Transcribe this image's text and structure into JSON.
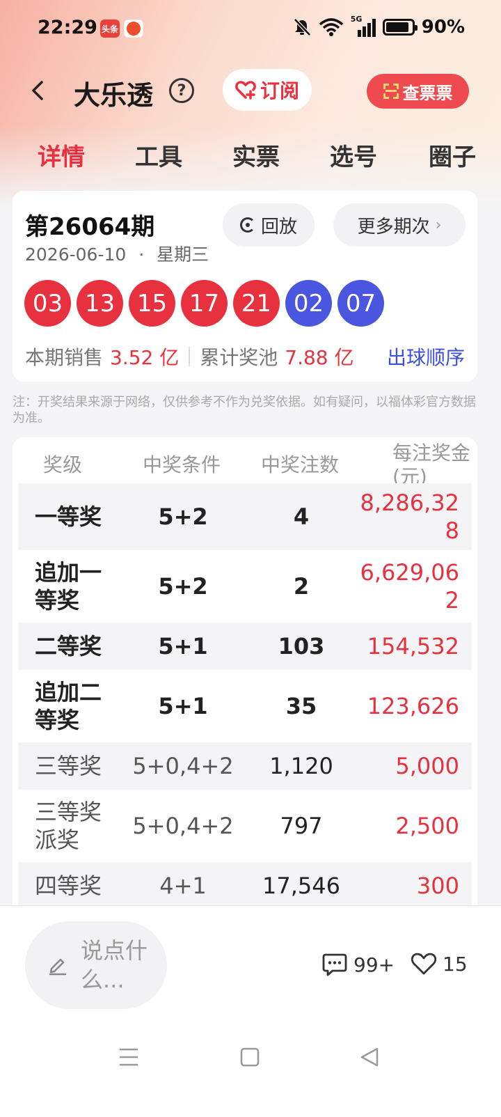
{
  "status_bar": {
    "time": "22:29",
    "app_badge": "头条",
    "network": "5G",
    "battery": "90%",
    "battery_level": 0.9
  },
  "header": {
    "title": "大乐透",
    "help_icon": "?",
    "subscribe_label": "订阅",
    "check_ticket_label": "查票票"
  },
  "tabs": [
    {
      "label": "详情",
      "active": true
    },
    {
      "label": "工具",
      "active": false
    },
    {
      "label": "实票",
      "active": false
    },
    {
      "label": "选号",
      "active": false
    },
    {
      "label": "圈子",
      "active": false
    }
  ],
  "draw": {
    "period": "第26064期",
    "date": "2026-06-10",
    "dot": "·",
    "weekday": "星期三",
    "replay_label": "回放",
    "more_label": "更多期次",
    "chevron": "›",
    "red_balls": [
      "03",
      "13",
      "15",
      "17",
      "21"
    ],
    "blue_balls": [
      "02",
      "07"
    ],
    "sales_label": "本期销售",
    "sales_value": "3.52 亿",
    "pool_label": "累计奖池",
    "pool_value": "7.88 亿",
    "order_link": "出球顺序"
  },
  "disclaimer": "注：开奖结果来源于网络，仅供参考不作为兑奖依据。如有疑问，以福体彩官方数据为准。",
  "prize_table": {
    "headers": {
      "prize": "奖级",
      "condition": "中奖条件",
      "count": "中奖注数",
      "amount": "每注奖金(元)"
    },
    "rows": [
      {
        "prize": "一等奖",
        "condition": "5+2",
        "count": "4",
        "amount": "8,286,328"
      },
      {
        "prize": "追加一等奖",
        "condition": "5+2",
        "count": "2",
        "amount": "6,629,062"
      },
      {
        "prize": "二等奖",
        "condition": "5+1",
        "count": "103",
        "amount": "154,532"
      },
      {
        "prize": "追加二等奖",
        "condition": "5+1",
        "count": "35",
        "amount": "123,626"
      },
      {
        "prize": "三等奖",
        "condition": "5+0,4+2",
        "count": "1,120",
        "amount": "5,000"
      },
      {
        "prize": "三等奖派奖",
        "condition": "5+0,4+2",
        "count": "797",
        "amount": "2,500"
      },
      {
        "prize": "四等奖",
        "condition": "4+1",
        "count": "17,546",
        "amount": "300"
      }
    ]
  },
  "bottom_bar": {
    "comment_placeholder": "说点什么...",
    "comment_count": "99+",
    "like_count": "15"
  },
  "colors": {
    "accent_red": "#e8313f",
    "blue_ball": "#4a55e0",
    "link_blue": "#3d4fd8"
  },
  "icons": [
    "back-icon",
    "help-icon",
    "heart-plus-icon",
    "scan-icon",
    "replay-icon",
    "chevron-right-icon",
    "pen-icon",
    "comment-icon",
    "heart-icon",
    "menu-icon",
    "home-icon",
    "back-triangle-icon"
  ]
}
